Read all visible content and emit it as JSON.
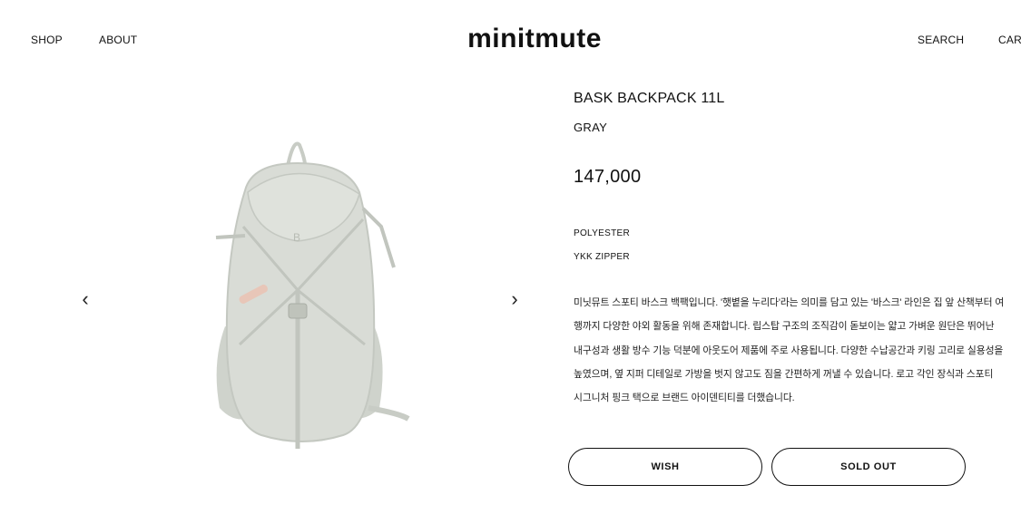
{
  "header": {
    "nav_left": [
      "SHOP",
      "ABOUT"
    ],
    "logo": "minitmute",
    "nav_right": [
      "SEARCH",
      "CART"
    ]
  },
  "gallery": {
    "prev_icon": "chevron-left-icon",
    "next_icon": "chevron-right-icon",
    "prev_glyph": "‹",
    "next_glyph": "›",
    "image": "backpack-image"
  },
  "product": {
    "title": "BASK BACKPACK 11L",
    "color": "GRAY",
    "price": "147,000",
    "specs": [
      "POLYESTER",
      "YKK ZIPPER"
    ],
    "description": "미닛뮤트 스포티 바스크 백팩입니다. '햇볕을 누리다'라는 의미를 담고 있는 '바스크' 라인은 집 앞 산책부터 여행까지 다양한 야외 활동을 위해 존재합니다. 립스탑 구조의 조직감이 돋보이는 얇고 가벼운 원단은 뛰어난 내구성과 생활 방수 기능 덕분에 아웃도어 제품에 주로 사용됩니다. 다양한 수납공간과 키링 고리로 실용성을 높였으며, 옆 지퍼 디테일로 가방을 벗지 않고도 짐을 간편하게 꺼낼 수 있습니다. 로고 각인 장식과 스포티 시그니처 핑크 택으로 브랜드 아이덴티티를 더했습니다."
  },
  "actions": {
    "wish_label": "WISH",
    "soldout_label": "SOLD OUT"
  },
  "colors": {
    "bag_body": "#d9dcd6",
    "bag_shadow": "#c4c8c1",
    "pink_tag": "#e8c6b8"
  }
}
